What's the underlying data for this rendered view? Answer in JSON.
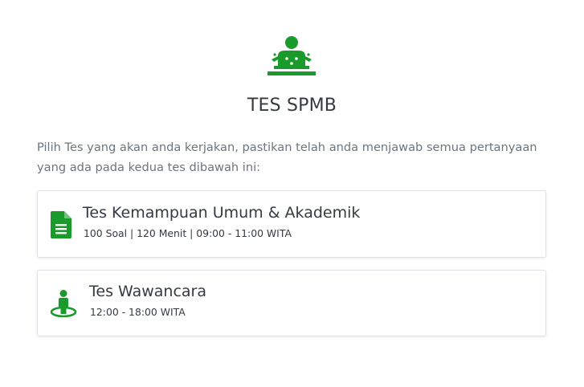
{
  "colors": {
    "accent": "#1b9a2c",
    "title": "#343a40",
    "muted": "#6c757d",
    "card_border": "#dfe3e8"
  },
  "header": {
    "icon": "teacher-at-desk-icon",
    "title": "TES SPMB"
  },
  "intro": {
    "text": "Pilih Tes yang akan anda kerjakan, pastikan telah anda menjawab semua pertanyaan yang ada pada kedua tes dibawah ini:"
  },
  "tests": [
    {
      "icon": "document-icon",
      "title": "Tes Kemampuan Umum & Akademik",
      "meta": "100 Soal | 120 Menit | 09:00 - 11:00 WITA"
    },
    {
      "icon": "person-location-icon",
      "title": "Tes Wawancara",
      "meta": "12:00 - 18:00 WITA"
    }
  ]
}
